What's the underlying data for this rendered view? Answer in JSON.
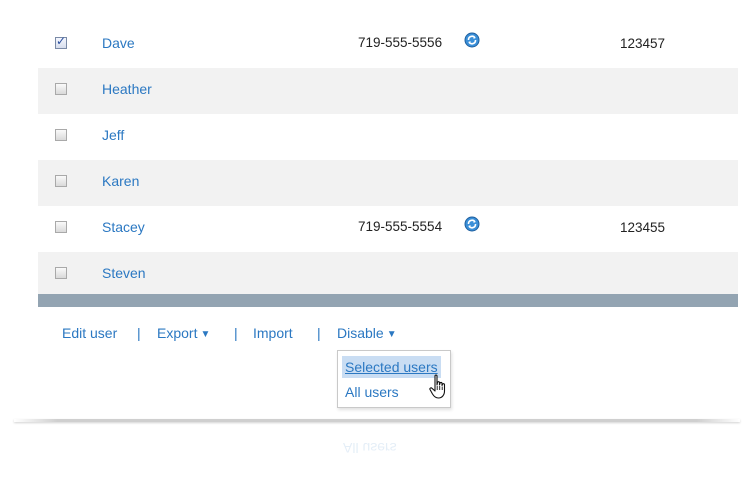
{
  "users": [
    {
      "checked": true,
      "name": "Dave",
      "phone": "719-555-5556",
      "ext": "123457",
      "alt": false
    },
    {
      "checked": false,
      "name": "Heather",
      "phone": "",
      "ext": "",
      "alt": true
    },
    {
      "checked": false,
      "name": "Jeff",
      "phone": "",
      "ext": "",
      "alt": false
    },
    {
      "checked": false,
      "name": "Karen",
      "phone": "",
      "ext": "",
      "alt": true
    },
    {
      "checked": false,
      "name": "Stacey",
      "phone": "719-555-5554",
      "ext": "123455",
      "alt": false
    },
    {
      "checked": false,
      "name": "Steven",
      "phone": "",
      "ext": "",
      "alt": true
    }
  ],
  "toolbar": {
    "edit_user": "Edit user",
    "separator": "|",
    "export": "Export",
    "import": "Import",
    "disable": "Disable",
    "caret": "▼"
  },
  "disable_menu": {
    "items": [
      "Selected users",
      "All users"
    ],
    "hovered_index": 0
  },
  "icons": {
    "phone_status": "phone-refresh-icon",
    "cursor": "hand-pointer-cursor"
  },
  "colors": {
    "link": "#2b78c2",
    "row_alt": "#f2f2f2",
    "divider": "#93a4b2",
    "menu_hover": "#c9ddf3"
  }
}
